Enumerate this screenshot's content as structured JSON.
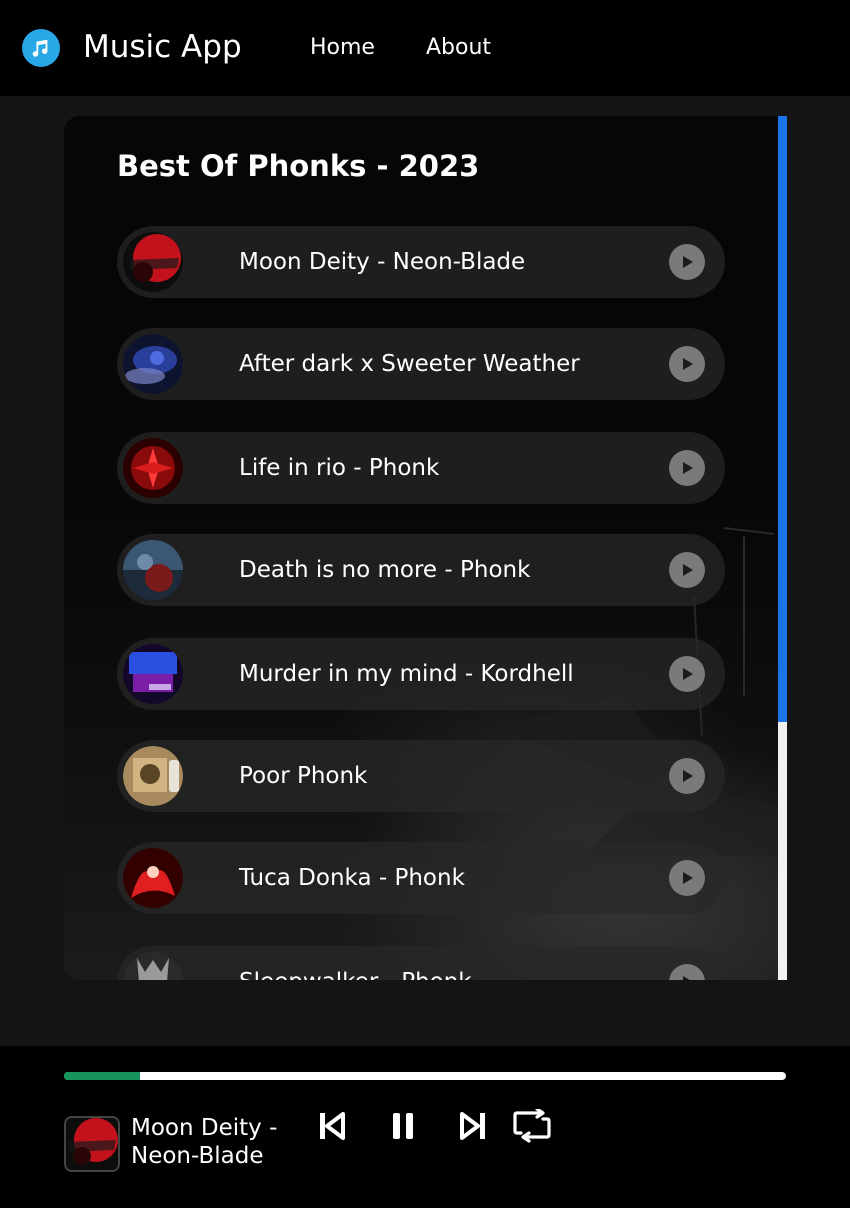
{
  "header": {
    "app_title": "Music App",
    "nav": [
      {
        "label": "Home"
      },
      {
        "label": "About"
      }
    ],
    "logo_icon": "music-note-icon",
    "logo_color": "#29a8e8"
  },
  "playlist": {
    "title": "Best Of Phonks - 2023",
    "songs": [
      {
        "name": "Moon Deity - Neon-Blade",
        "cover_icon": "album-art-red"
      },
      {
        "name": "After dark x Sweeter Weather",
        "cover_icon": "album-art-blue"
      },
      {
        "name": "Life in rio - Phonk",
        "cover_icon": "album-art-red"
      },
      {
        "name": "Death is no more - Phonk",
        "cover_icon": "album-art-dark"
      },
      {
        "name": "Murder in my mind - Kordhell",
        "cover_icon": "album-art-purple"
      },
      {
        "name": "Poor Phonk",
        "cover_icon": "album-art-tan"
      },
      {
        "name": "Tuca Donka - Phonk",
        "cover_icon": "album-art-red"
      },
      {
        "name": "Sleepwalker - Phonk",
        "cover_icon": "album-art-gray"
      }
    ],
    "play_icon": "play-circle-icon",
    "scroll_accent": "#1a73e8"
  },
  "player": {
    "now_playing": "Moon Deity - Neon-Blade",
    "progress": 0.105,
    "progress_color": "#16935a",
    "controls": [
      {
        "icon": "skip-previous-icon"
      },
      {
        "icon": "pause-icon"
      },
      {
        "icon": "skip-next-icon"
      },
      {
        "icon": "repeat-icon"
      }
    ]
  }
}
